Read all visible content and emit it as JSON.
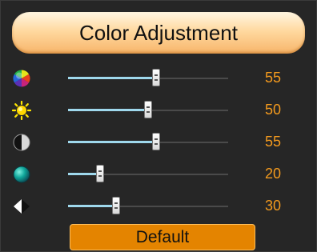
{
  "header": {
    "title": "Color Adjustment"
  },
  "rows": [
    {
      "icon": "hue-icon",
      "value": "55",
      "level": 55
    },
    {
      "icon": "brightness-icon",
      "value": "50",
      "level": 50
    },
    {
      "icon": "contrast-icon",
      "value": "55",
      "level": 55
    },
    {
      "icon": "saturation-icon",
      "value": "20",
      "level": 20
    },
    {
      "icon": "sharpness-icon",
      "value": "30",
      "level": 30
    }
  ],
  "default_button": {
    "label": "Default"
  },
  "colors": {
    "accent": "#f39a1e",
    "button": "#e48400",
    "track_fill": "#9fd8ec"
  }
}
